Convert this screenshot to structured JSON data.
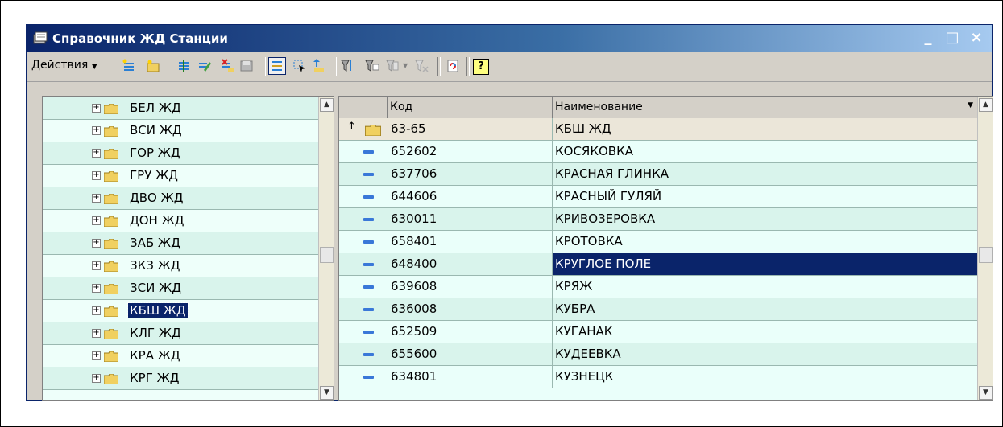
{
  "window": {
    "title": "Справочник ЖД Станции",
    "controls": [
      "_",
      "□",
      "×"
    ]
  },
  "toolbar": {
    "actions_label": "Действия",
    "help_label": "?"
  },
  "tree": {
    "items": [
      {
        "label": "БЕЛ ЖД",
        "selected": false
      },
      {
        "label": "ВСИ ЖД",
        "selected": false
      },
      {
        "label": "ГОР ЖД",
        "selected": false
      },
      {
        "label": "ГРУ ЖД",
        "selected": false
      },
      {
        "label": "ДВО ЖД",
        "selected": false
      },
      {
        "label": "ДОН ЖД",
        "selected": false
      },
      {
        "label": "ЗАБ ЖД",
        "selected": false
      },
      {
        "label": "ЗКЗ ЖД",
        "selected": false
      },
      {
        "label": "ЗСИ ЖД",
        "selected": false
      },
      {
        "label": "КБШ ЖД",
        "selected": true
      },
      {
        "label": "КЛГ ЖД",
        "selected": false
      },
      {
        "label": "КРА ЖД",
        "selected": false
      },
      {
        "label": "КРГ ЖД",
        "selected": false
      }
    ]
  },
  "grid": {
    "columns": {
      "code": "Код",
      "name": "Наименование"
    },
    "parent": {
      "code": "63-65",
      "name": "КБШ ЖД"
    },
    "rows": [
      {
        "code": "652602",
        "name": "КОСЯКОВКА",
        "selected": false
      },
      {
        "code": "637706",
        "name": "КРАСНАЯ ГЛИНКА",
        "selected": false
      },
      {
        "code": "644606",
        "name": "КРАСНЫЙ ГУЛЯЙ",
        "selected": false
      },
      {
        "code": "630011",
        "name": "КРИВОЗЕРОВКА",
        "selected": false
      },
      {
        "code": "658401",
        "name": "КРОТОВКА",
        "selected": false
      },
      {
        "code": "648400",
        "name": "КРУГЛОЕ ПОЛЕ",
        "selected": true
      },
      {
        "code": "639608",
        "name": "КРЯЖ",
        "selected": false
      },
      {
        "code": "636008",
        "name": "КУБРА",
        "selected": false
      },
      {
        "code": "652509",
        "name": "КУГАНАК",
        "selected": false
      },
      {
        "code": "655600",
        "name": "КУДЕЕВКА",
        "selected": false
      },
      {
        "code": "634801",
        "name": "КУЗНЕЦК",
        "selected": false
      }
    ]
  },
  "colors": {
    "title_bg": "#0a246a",
    "selection": "#0a246a",
    "row_alt": "#d9f4ec",
    "row": "#eafffa"
  }
}
